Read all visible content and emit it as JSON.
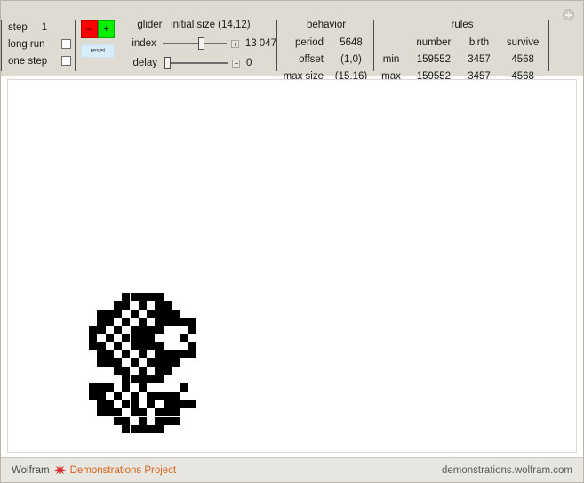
{
  "window": {
    "expand_icon": "plus-circle-icon"
  },
  "controls": {
    "step": {
      "label": "step",
      "value": "1"
    },
    "long_run": {
      "label": "long run",
      "checked": false
    },
    "one_step": {
      "label": "one step",
      "checked": false
    },
    "decrement_label": "–",
    "increment_label": "+",
    "reset_label": "reset",
    "colors": {
      "decrement_bg": "#ff0000",
      "increment_bg": "#00ee00",
      "reset_bg": "#d9ecfb",
      "panel_bg": "#dedbd2",
      "accent": "#d4661f"
    }
  },
  "glider": {
    "title_word": "glider",
    "initial_size_label": "initial size",
    "initial_size_value": "(14,12)",
    "index": {
      "label": "index",
      "value": "13 047",
      "position_pct": 62
    },
    "delay": {
      "label": "delay",
      "value": "0",
      "position_pct": 2
    }
  },
  "behavior": {
    "header": "behavior",
    "rows": [
      {
        "key": "period",
        "value": "5648"
      },
      {
        "key": "offset",
        "value": "(1,0)"
      },
      {
        "key": "max size",
        "value": "(15,16)"
      }
    ]
  },
  "rules": {
    "header": "rules",
    "columns": [
      "number",
      "birth",
      "survive"
    ],
    "rows": [
      {
        "label": "min",
        "number": "159552",
        "birth": "3457",
        "survive": "4568"
      },
      {
        "label": "max",
        "number": "159552",
        "birth": "3457",
        "survive": "4568"
      }
    ]
  },
  "canvas": {
    "cell_size": 9.3,
    "cell_color": "#000000",
    "background": "#ffffff",
    "pattern": [
      "000011111000000",
      "000110101100000",
      "011101011110000",
      "011010101111100",
      "110101111000100",
      "101011110001000",
      "110101111000100",
      "011010101111100",
      "011101011110000",
      "000110101100000",
      "000011111000000",
      "111010100001000",
      "110101011110000",
      "011011010111100",
      "011101101110000",
      "000110101110000",
      "000011111000000"
    ]
  },
  "footer": {
    "brand_prefix": "Wolfram",
    "brand_icon": "wolfram-spikey-icon",
    "brand_suffix": "Demonstrations Project",
    "url": "demonstrations.wolfram.com"
  }
}
